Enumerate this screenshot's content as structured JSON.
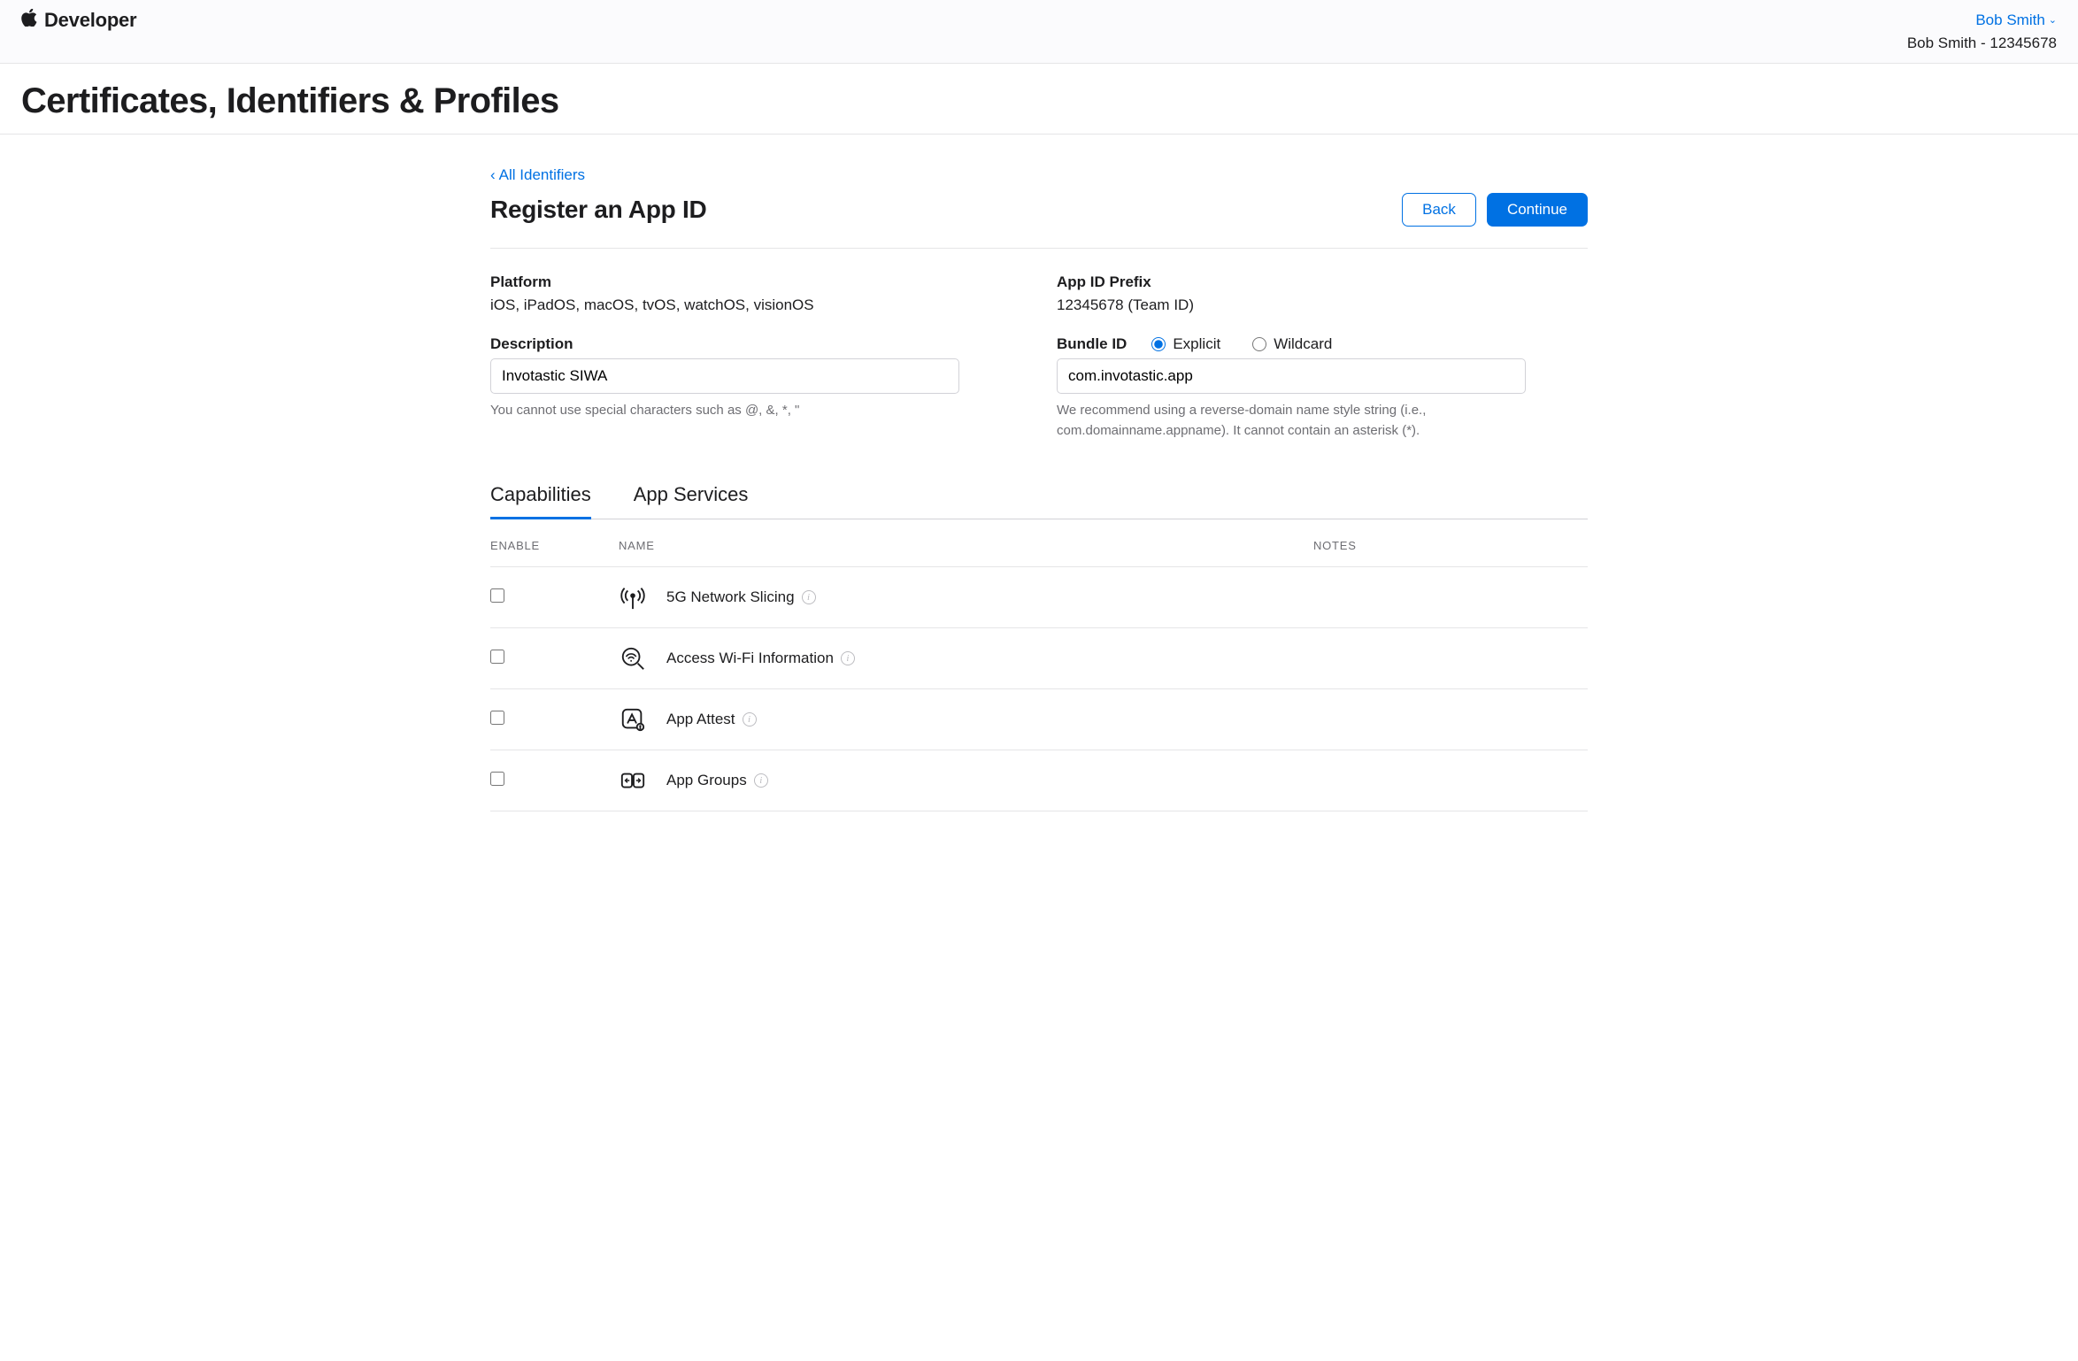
{
  "header": {
    "brand_label": "Developer",
    "account_name": "Bob Smith",
    "account_sub": "Bob Smith - 12345678"
  },
  "page_title": "Certificates, Identifiers & Profiles",
  "back_link": "All Identifiers",
  "section": {
    "title": "Register an App ID",
    "back_btn": "Back",
    "continue_btn": "Continue"
  },
  "form": {
    "platform_label": "Platform",
    "platform_value": "iOS, iPadOS, macOS, tvOS, watchOS, visionOS",
    "prefix_label": "App ID Prefix",
    "prefix_value": "12345678 (Team ID)",
    "description_label": "Description",
    "description_value": "Invotastic SIWA",
    "description_help": "You cannot use special characters such as @, &, *, \"",
    "bundle_label": "Bundle ID",
    "bundle_value": "com.invotastic.app",
    "bundle_help": "We recommend using a reverse-domain name style string (i.e., com.domainname.appname). It cannot contain an asterisk (*).",
    "radio_explicit": "Explicit",
    "radio_wildcard": "Wildcard"
  },
  "tabs": {
    "capabilities": "Capabilities",
    "app_services": "App Services"
  },
  "table": {
    "col_enable": "ENABLE",
    "col_name": "NAME",
    "col_notes": "NOTES",
    "rows": [
      {
        "label": "5G Network Slicing",
        "icon": "antenna"
      },
      {
        "label": "Access Wi-Fi Information",
        "icon": "wifi-search"
      },
      {
        "label": "App Attest",
        "icon": "app-attest"
      },
      {
        "label": "App Groups",
        "icon": "app-groups"
      }
    ]
  }
}
